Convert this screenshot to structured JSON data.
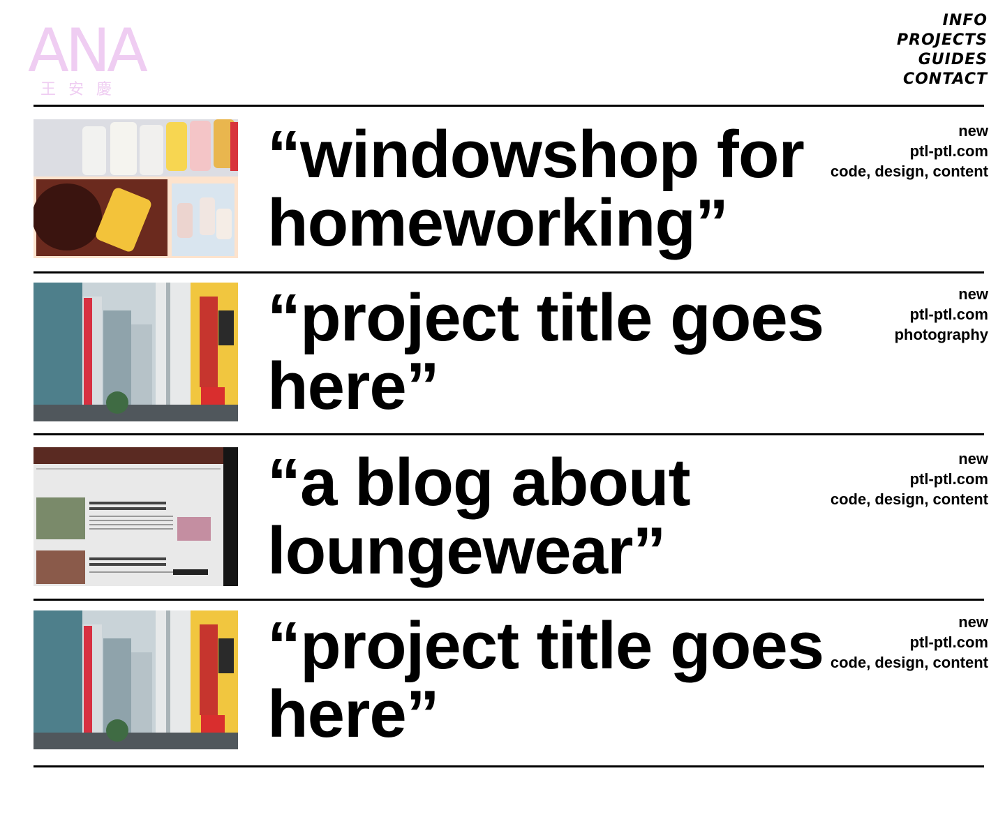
{
  "logo": {
    "main": "ANA",
    "sub": "王安慶",
    "color": "#efcdf2"
  },
  "nav": {
    "items": [
      "INFO",
      "PROJECTS",
      "GUIDES",
      "CONTACT"
    ]
  },
  "projects": [
    {
      "title": "“windowshop for homeworking”",
      "status": "new",
      "site": "ptl-ptl.com",
      "tags": "code, design, content",
      "thumbnail": "ptl-beauty-products"
    },
    {
      "title": "“project title goes here”",
      "status": "new",
      "site": "ptl-ptl.com",
      "tags": "photography",
      "thumbnail": "city-street"
    },
    {
      "title": "“a blog about loungewear”",
      "status": "new",
      "site": "ptl-ptl.com",
      "tags": "code, design, content",
      "thumbnail": "blog-screen"
    },
    {
      "title": "“project title goes here”",
      "status": "new",
      "site": "ptl-ptl.com",
      "tags": "code, design, content",
      "thumbnail": "city-street"
    }
  ]
}
